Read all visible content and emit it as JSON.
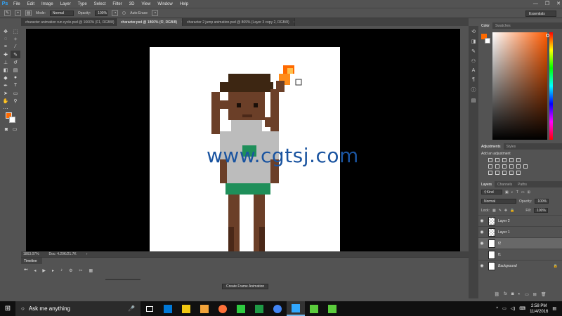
{
  "menubar": {
    "logo": "Ps",
    "items": [
      "File",
      "Edit",
      "Image",
      "Layer",
      "Type",
      "Select",
      "Filter",
      "3D",
      "View",
      "Window",
      "Help"
    ],
    "window_controls": [
      "—",
      "❐",
      "✕"
    ]
  },
  "options": {
    "mode_label": "Mode:",
    "mode_value": "Normal",
    "opacity_label": "Opacity:",
    "opacity_value": "100%",
    "auto_erase_label": "Auto Erase",
    "workspace": "Essentials"
  },
  "tabs": [
    {
      "label": "character animation run cycle.psd @ 1660% (F1, RGB/8)",
      "active": false
    },
    {
      "label": "character.psd @ 1860% (f2, RGB/8)",
      "active": true
    },
    {
      "label": "character 2 jump animation.psd @ 869% (Layer 3 copy 2, RGB/8)",
      "active": false
    }
  ],
  "status": {
    "zoom": "1863.07%",
    "doc": "Doc: 4.20K/21.7K"
  },
  "timeline": {
    "tab_label": "Timeline",
    "create_button": "Create Frame Animation"
  },
  "color_panel": {
    "tabs": [
      "Color",
      "Swatches"
    ],
    "fg_color": "#ff6a00"
  },
  "adjustments": {
    "tabs": [
      "Adjustments",
      "Styles"
    ],
    "hint": "Add an adjustment"
  },
  "layers_panel": {
    "tabs": [
      "Layers",
      "Channels",
      "Paths"
    ],
    "kind_filter": "Kind",
    "blend_mode": "Normal",
    "opacity_label": "Opacity:",
    "opacity_value": "100%",
    "lock_label": "Lock:",
    "fill_label": "Fill:",
    "fill_value": "100%",
    "layers": [
      {
        "name": "Layer 2",
        "selected": false
      },
      {
        "name": "Layer 1",
        "selected": false
      },
      {
        "name": "f2",
        "selected": true
      },
      {
        "name": "f1",
        "selected": false
      },
      {
        "name": "Background",
        "selected": false
      }
    ]
  },
  "watermark": "www.cgtsj.com",
  "taskbar": {
    "search_placeholder": "Ask me anything",
    "time": "2:58 PM",
    "date": "11/4/2016",
    "app_colors": [
      "#3a96dd",
      "#0078d7",
      "#f2c811",
      "#f2a33a",
      "#ff7139",
      "#2ecc40",
      "#1e9a45",
      "#4285f4",
      "#31a8ff",
      "#5bcc3c",
      "#5bcc3c"
    ]
  }
}
